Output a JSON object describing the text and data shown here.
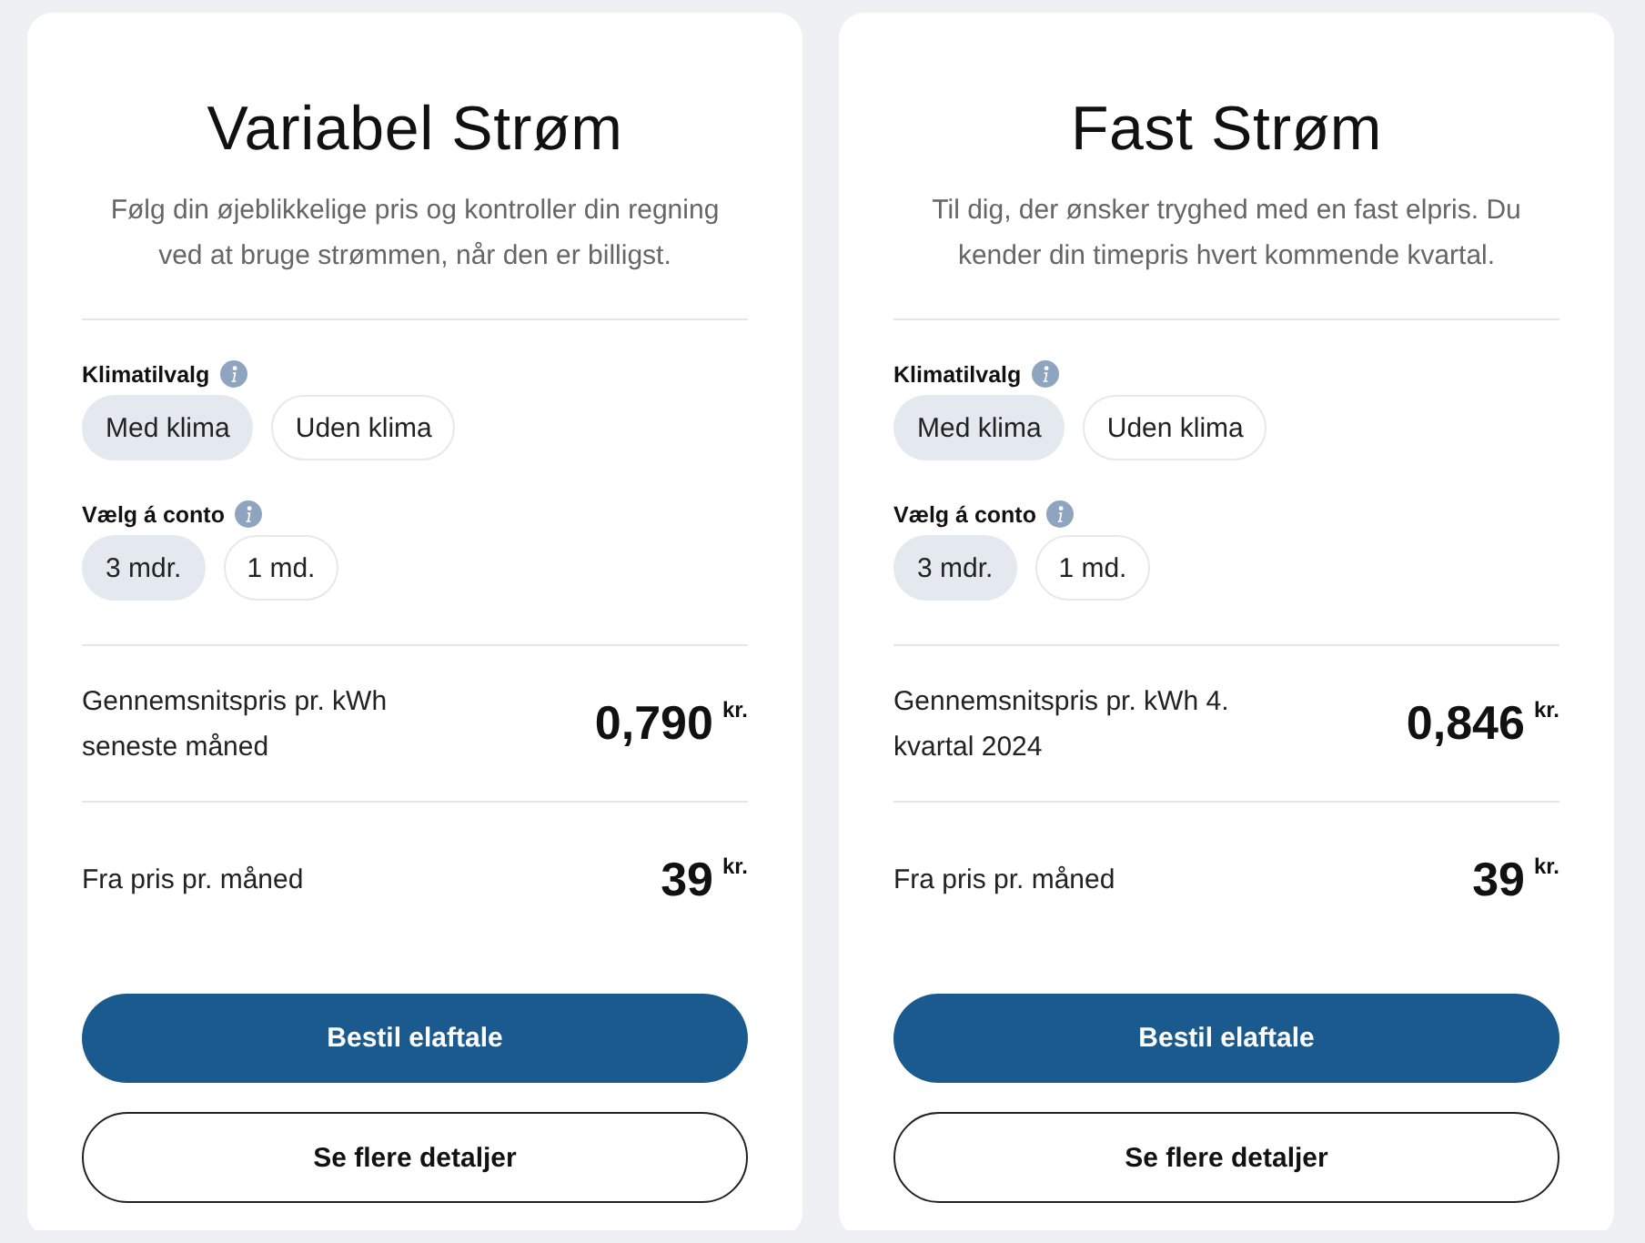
{
  "plans": [
    {
      "title": "Variabel Strøm",
      "description": "Følg din øjeblikkelige pris og kontroller din regning ved at bruge strømmen, når den er billigst.",
      "option_groups": [
        {
          "label": "Klimatilvalg",
          "options": [
            {
              "label": "Med klima",
              "selected": true
            },
            {
              "label": "Uden klima",
              "selected": false
            }
          ]
        },
        {
          "label": "Vælg á conto",
          "options": [
            {
              "label": "3 mdr.",
              "selected": true
            },
            {
              "label": "1 md.",
              "selected": false
            }
          ]
        }
      ],
      "prices": [
        {
          "label": "Gennemsnitspris pr. kWh seneste måned",
          "value": "0,790",
          "unit": "kr."
        },
        {
          "label": "Fra pris pr. måned",
          "value": "39",
          "unit": "kr."
        }
      ],
      "primary_button": "Bestil elaftale",
      "secondary_button": "Se flere detaljer"
    },
    {
      "title": "Fast Strøm",
      "description": "Til dig, der ønsker tryghed med en fast elpris. Du kender din timepris hvert kommende kvartal.",
      "option_groups": [
        {
          "label": "Klimatilvalg",
          "options": [
            {
              "label": "Med klima",
              "selected": true
            },
            {
              "label": "Uden klima",
              "selected": false
            }
          ]
        },
        {
          "label": "Vælg á conto",
          "options": [
            {
              "label": "3 mdr.",
              "selected": true
            },
            {
              "label": "1 md.",
              "selected": false
            }
          ]
        }
      ],
      "prices": [
        {
          "label": "Gennemsnitspris pr. kWh 4. kvartal 2024",
          "value": "0,846",
          "unit": "kr."
        },
        {
          "label": "Fra pris pr. måned",
          "value": "39",
          "unit": "kr."
        }
      ],
      "primary_button": "Bestil elaftale",
      "secondary_button": "Se flere detaljer"
    }
  ]
}
